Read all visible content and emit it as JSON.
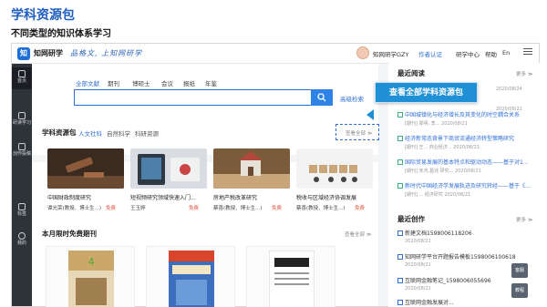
{
  "slide": {
    "title": "学科资源包",
    "subtitle": "不同类型的知识体系学习"
  },
  "topbar": {
    "logo_mark": "知",
    "logo_text": "知网研学",
    "slogan": "品格文, 上知网研学",
    "user_name": "知网研学GZY",
    "author_auth": "作者认证",
    "research_center": "研学中心",
    "help": "帮助",
    "lang": "En"
  },
  "sidebar": {
    "items": [
      {
        "label": "首页",
        "icon": "home-icon"
      },
      {
        "label": "研读学习",
        "icon": "book-icon"
      },
      {
        "label": "创作投稿",
        "icon": "pen-icon"
      },
      {
        "label": "标签",
        "icon": "tag-icon"
      },
      {
        "label": "我的",
        "icon": "user-icon"
      }
    ]
  },
  "search": {
    "tabs": [
      "全部文献",
      "期刊",
      "博硕士",
      "会议",
      "报纸",
      "年鉴"
    ],
    "placeholder": "",
    "advanced": "高级检索"
  },
  "tooltip": {
    "text": "查看全部学科资源包"
  },
  "packages": {
    "title": "学科资源包",
    "tabs": [
      "人文社科",
      "自然科学",
      "科研资源"
    ],
    "more": "查看全部 ≫",
    "cards": [
      {
        "title": "中国财政制度研究",
        "author": "谭光荣(教授、博士生...)",
        "free": "免费"
      },
      {
        "title": "短视频研究领域快速入门...",
        "author": "王玉婷",
        "free": "免费"
      },
      {
        "title": "房地产税改革研究",
        "author": "蔡喜(教授、博士生...)",
        "free": "免费"
      },
      {
        "title": "税收与区域经济协调发展",
        "author": "蔡喜(教授、博士生...)",
        "free": "免费"
      }
    ]
  },
  "journals": {
    "title": "本月限时免费期刊",
    "more": "查看全部 ≫"
  },
  "recent_reading": {
    "title": "最近阅读",
    "more": "更多 ≫",
    "items": [
      {
        "title": "",
        "meta": "2020/08/24"
      },
      {
        "title": "",
        "meta": "2020/08/21"
      },
      {
        "title": "中国城镇化与经济增长及其变化的时空耦合关系",
        "meta": "[期刊] 郑明, 李... 2020/08/21"
      },
      {
        "title": "经济新常态背景下商贸流通经济转型策略研究",
        "meta": "[期刊] 王... 商业经济... 2020/08/21"
      },
      {
        "title": "国际贸易发展的基本特点和驱动动态——基于对1...",
        "meta": "[期刊] 宋鸿,葛兆 研究... 2020/08/21"
      },
      {
        "title": "新时代中国经济学发展轨迹及研究转经——基于《...",
        "meta": "[期刊] ... 经济研究 2020/08/21"
      }
    ]
  },
  "recent_creation": {
    "title": "最近创作",
    "more": "更多 ≫",
    "items": [
      {
        "title": "新建文档1598006118206",
        "meta": "2020/08/21"
      },
      {
        "title": "知网研学平台开题报告模板1598006100618",
        "meta": "2020/08/21"
      },
      {
        "title": "互联网金融笔记_1598006055696",
        "meta": "2020/08/21"
      },
      {
        "title": "互联网金融发展对...",
        "meta": ""
      }
    ]
  },
  "float_buttons": [
    {
      "label": "客服",
      "icon": "headset-icon"
    },
    {
      "label": "教程",
      "icon": "play-icon"
    }
  ]
}
